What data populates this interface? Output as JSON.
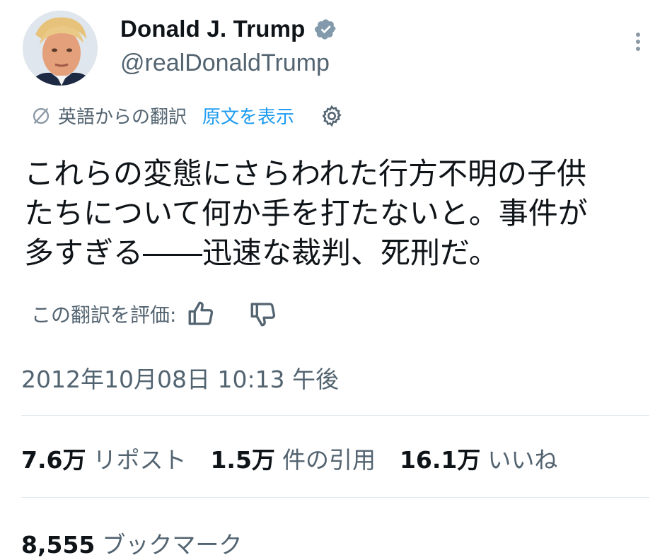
{
  "author": {
    "display_name": "Donald J. Trump",
    "handle": "@realDonaldTrump",
    "verified_icon": "verified-badge-icon"
  },
  "translation": {
    "label": "英語からの翻訳",
    "show_original": "原文を表示"
  },
  "tweet": {
    "lines": [
      "これらの変態にさらわれた行方不明の子供",
      "たちについて何か手を打たないと。事件が",
      "多すぎる――迅速な裁判、死刑だ。"
    ]
  },
  "rating": {
    "label": "この翻訳を評価:"
  },
  "timestamp": "2012年10月08日 10:13 午後",
  "stats": {
    "reposts_count": "7.6万",
    "reposts_label": "リポスト",
    "quotes_count": "1.5万",
    "quotes_label": "件の引用",
    "likes_count": "16.1万",
    "likes_label": "いいね"
  },
  "bookmarks": {
    "count": "8,555",
    "label": "ブックマーク"
  },
  "colors": {
    "link": "#1d9bf0",
    "muted": "#536471",
    "verified": "#829aab"
  }
}
